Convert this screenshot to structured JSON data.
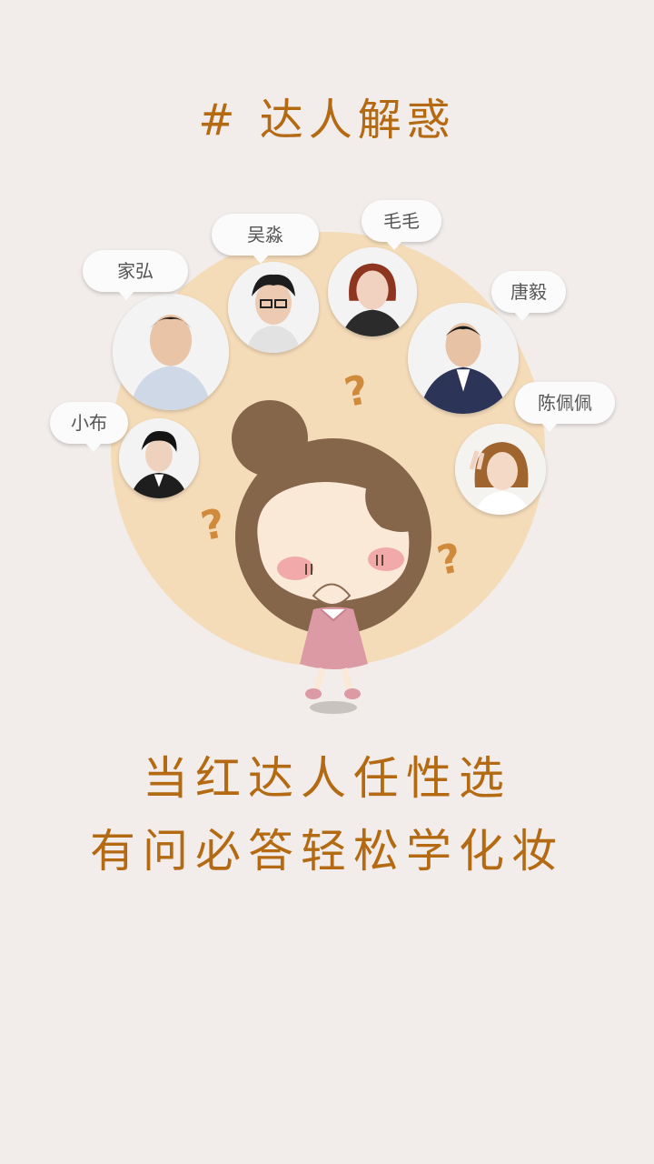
{
  "title": "# 达人解惑",
  "experts": [
    {
      "name": "家弘"
    },
    {
      "name": "吴淼"
    },
    {
      "name": "毛毛"
    },
    {
      "name": "唐毅"
    },
    {
      "name": "陈佩佩"
    },
    {
      "name": "小布"
    }
  ],
  "slogan": {
    "line1": "当红达人任性选",
    "line2": "有问必答轻松学化妆"
  },
  "colors": {
    "background": "#f2ecea",
    "accent": "#b36a12",
    "circle": "#f5dcb9"
  },
  "icons": [
    "question-mark-icon",
    "cartoon-girl-illustration"
  ]
}
